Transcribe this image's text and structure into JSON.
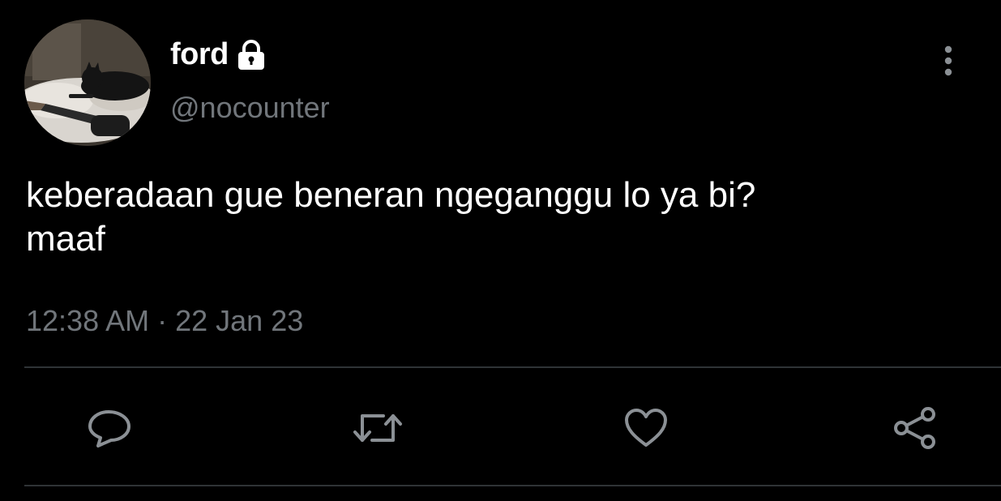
{
  "tweet": {
    "author": {
      "display_name": "ford",
      "handle": "@nocounter",
      "protected_icon": "lock-icon",
      "avatar": "cat-on-bed-with-guitar-photo"
    },
    "text": "keberadaan gue beneran ngeganggu lo ya bi?\nmaaf",
    "time": "12:38 AM",
    "separator": " · ",
    "date": "22 Jan 23"
  },
  "header": {
    "more_icon": "more-vertical-icon"
  },
  "actions": {
    "reply_icon": "reply-icon",
    "retweet_icon": "retweet-icon",
    "like_icon": "heart-icon",
    "share_icon": "share-icon"
  },
  "colors": {
    "background": "#000000",
    "text_primary": "#ffffff",
    "text_secondary": "#71767b",
    "divider": "#2f3336"
  }
}
